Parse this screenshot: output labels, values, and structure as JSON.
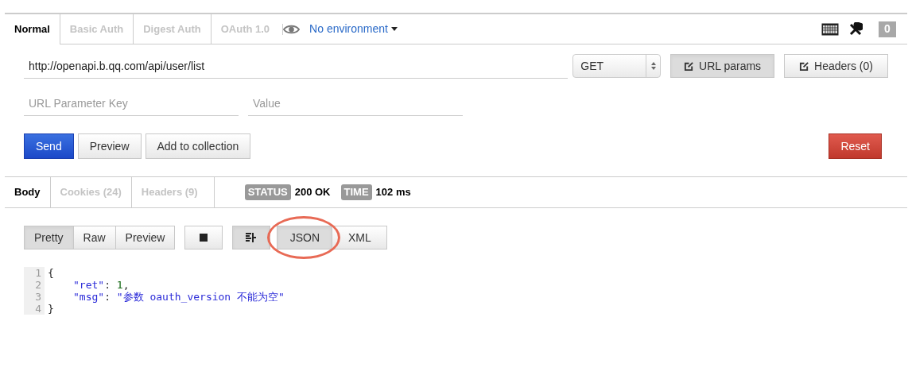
{
  "auth_tabs": [
    {
      "label": "Normal",
      "selected": true
    },
    {
      "label": "Basic Auth",
      "selected": false
    },
    {
      "label": "Digest Auth",
      "selected": false
    },
    {
      "label": "OAuth 1.0",
      "selected": false
    }
  ],
  "environment": {
    "label": "No environment"
  },
  "counter": "0",
  "request": {
    "url": "http://openapi.b.qq.com/api/user/list",
    "method": "GET",
    "buttons": [
      {
        "label": "URL params",
        "selected": true
      },
      {
        "label": "Headers (0)",
        "selected": false
      }
    ]
  },
  "params": {
    "key_placeholder": "URL Parameter Key",
    "value_placeholder": "Value"
  },
  "actions": [
    {
      "label": "Send",
      "kind": "primary"
    },
    {
      "label": "Preview",
      "kind": "default"
    },
    {
      "label": "Add to collection",
      "kind": "default"
    },
    {
      "label": "Reset",
      "kind": "danger"
    }
  ],
  "response_tabs": [
    {
      "label": "Body",
      "selected": true
    },
    {
      "label": "Cookies (24)",
      "selected": false
    },
    {
      "label": "Headers (9)",
      "selected": false
    }
  ],
  "status": {
    "status_label": "STATUS",
    "status_value": "200 OK",
    "time_label": "TIME",
    "time_value": "102 ms"
  },
  "view_modes": [
    {
      "label": "Pretty",
      "selected": true
    },
    {
      "label": "Raw",
      "selected": false
    },
    {
      "label": "Preview",
      "selected": false
    }
  ],
  "wrap_selected": true,
  "formats": [
    {
      "label": "JSON",
      "selected": true
    },
    {
      "label": "XML",
      "selected": false
    }
  ],
  "code": [
    {
      "number": "1",
      "tokens": [
        {
          "kind": "punct",
          "text": "{"
        }
      ],
      "children": [
        {
          "number": "2",
          "tokens": [
            {
              "kind": "key",
              "text": "\"ret\""
            },
            {
              "kind": "punct",
              "text": ": "
            },
            {
              "kind": "number",
              "text": "1"
            },
            {
              "kind": "punct",
              "text": ","
            }
          ]
        },
        {
          "number": "3",
          "tokens": [
            {
              "kind": "key",
              "text": "\"msg\""
            },
            {
              "kind": "punct",
              "text": ": "
            },
            {
              "kind": "string",
              "text": "\"参数 oauth_version 不能为空\""
            }
          ]
        }
      ]
    },
    {
      "number": "4",
      "tokens": [
        {
          "kind": "punct",
          "text": "}"
        }
      ]
    }
  ]
}
